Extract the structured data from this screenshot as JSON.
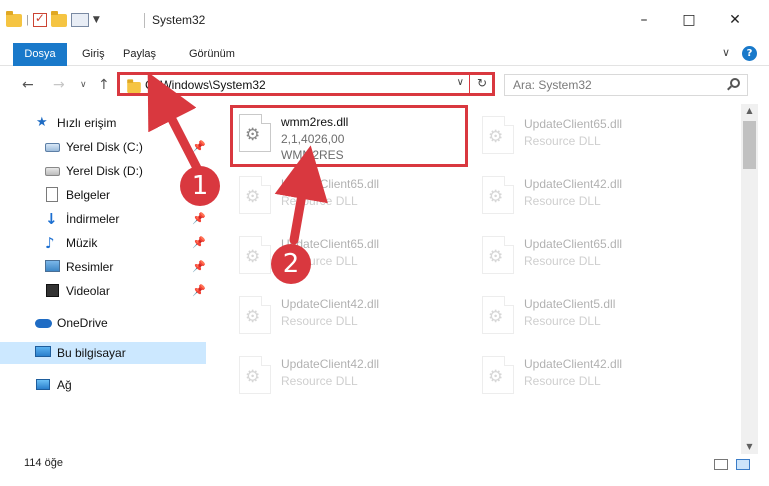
{
  "window": {
    "title": "System32",
    "qat_separator": "|",
    "minimize": "–",
    "maximize": "□",
    "close": "✕"
  },
  "ribbon": {
    "tabs": [
      "Dosya",
      "Giriş",
      "Paylaş",
      "Görünüm"
    ],
    "expand": "∨",
    "help": "?"
  },
  "nav": {
    "back": "←",
    "forward": "→",
    "recent": "∨",
    "up": "↑",
    "address": "C:\\Windows\\System32",
    "address_dropdown": "∨",
    "refresh": "↻",
    "search_placeholder": "Ara: System32"
  },
  "sidebar": {
    "items": [
      {
        "label": "Hızlı erişim",
        "icon": "quick-access-star-icon",
        "pinned": false
      },
      {
        "label": "Yerel Disk (C:)",
        "icon": "drive-c-icon",
        "pinned": true
      },
      {
        "label": "Yerel Disk (D:)",
        "icon": "drive-d-icon",
        "pinned": false
      },
      {
        "label": "Belgeler",
        "icon": "documents-icon",
        "pinned": false
      },
      {
        "label": "İndirmeler",
        "icon": "downloads-icon",
        "pinned": true
      },
      {
        "label": "Müzik",
        "icon": "music-icon",
        "pinned": true
      },
      {
        "label": "Resimler",
        "icon": "pictures-icon",
        "pinned": true
      },
      {
        "label": "Videolar",
        "icon": "videos-icon",
        "pinned": true
      },
      {
        "label": "OneDrive",
        "icon": "onedrive-icon",
        "pinned": false
      },
      {
        "label": "Bu bilgisayar",
        "icon": "this-pc-icon",
        "pinned": false,
        "selected": true
      },
      {
        "label": "Ağ",
        "icon": "network-icon",
        "pinned": false
      }
    ],
    "pin_glyph": "📌"
  },
  "files": [
    {
      "name": "wmm2res.dll",
      "line2": "2,1,4026,00",
      "line3": "WMM2RES",
      "highlighted": true
    },
    {
      "name": "UpdateClient65.dll",
      "line2": "Resource DLL",
      "line3": ""
    },
    {
      "name": "UpdateClient65.dll",
      "line2": "Resource DLL",
      "line3": ""
    },
    {
      "name": "UpdateClient42.dll",
      "line2": "Resource DLL",
      "line3": ""
    },
    {
      "name": "UpdateClient65.dll",
      "line2": "Resource DLL",
      "line3": ""
    },
    {
      "name": "UpdateClient65.dll",
      "line2": "Resource DLL",
      "line3": ""
    },
    {
      "name": "UpdateClient42.dll",
      "line2": "Resource DLL",
      "line3": ""
    },
    {
      "name": "UpdateClient5.dll",
      "line2": "Resource DLL",
      "line3": ""
    },
    {
      "name": "UpdateClient42.dll",
      "line2": "Resource DLL",
      "line3": ""
    },
    {
      "name": "UpdateClient42.dll",
      "line2": "Resource DLL",
      "line3": ""
    }
  ],
  "status": {
    "item_count": "114 öğe"
  },
  "annotations": {
    "badge1": "1",
    "badge2": "2",
    "color": "#d9383f"
  }
}
